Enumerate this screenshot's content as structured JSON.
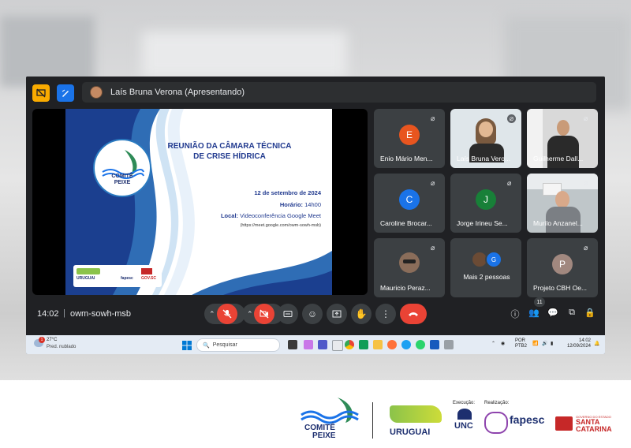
{
  "meet": {
    "presenter": "Laís Bruna Verona (Apresentando)",
    "time": "14:02",
    "code": "owm-sowh-msb",
    "participant_count": "11"
  },
  "slide": {
    "logo_line1": "COMITÊ",
    "logo_line2": "PEIXE",
    "title_line1": "REUNIÃO DA CÂMARA TÉCNICA",
    "title_line2": "DE CRISE HÍDRICA",
    "date": "12 de setembro de 2024",
    "hora_label": "Horário:",
    "hora_value": "14h00",
    "local_label": "Local:",
    "local_value": "Videoconferência Google Meet",
    "url": "(https://meet.google.com/owm-sowh-msb)",
    "footer_uruguai": "URUGUAI",
    "footer_fapesc": "fapesc",
    "footer_gov": "GOV.SC"
  },
  "participants": [
    {
      "name": "Enio Mário Men...",
      "initial": "E",
      "color": "#e8551f"
    },
    {
      "name": "Laís Bruna Vero...",
      "initial": "",
      "color": ""
    },
    {
      "name": "Guilherme Dall...",
      "initial": "",
      "color": ""
    },
    {
      "name": "Caroline Brocar...",
      "initial": "C",
      "color": "#1a73e8"
    },
    {
      "name": "Jorge Irineu Se...",
      "initial": "J",
      "color": "#188038"
    },
    {
      "name": "Murilo Anzanel...",
      "initial": "",
      "color": ""
    },
    {
      "name": "Mauricio Peraz...",
      "initial": "",
      "color": ""
    },
    {
      "name": "Mais 2 pessoas",
      "initial": "G",
      "color": "#1a73e8"
    },
    {
      "name": "Projeto CBH Oe...",
      "initial": "P",
      "color": "#a1887f"
    }
  ],
  "taskbar": {
    "temp": "27°C",
    "weather": "Pred. nublado",
    "search_placeholder": "Pesquisar",
    "lang1": "POR",
    "lang2": "PTB2",
    "clock_time": "14:02",
    "clock_date": "12/09/2024",
    "weather_badge": "1"
  },
  "footer": {
    "comite_line1": "COMITÊ",
    "comite_line2": "PEIXE",
    "uruguai": "URUGUAI",
    "execucao": "Execução:",
    "unc": "UNC",
    "realizacao": "Realização:",
    "fapesc": "fapesc",
    "gov_line1": "GOVERNO DO ESTADO",
    "gov_line2": "SANTA",
    "gov_line3": "CATARINA"
  },
  "colors": {
    "meet_bg": "#202124",
    "end_call": "#ea4335",
    "slide_blue": "#213a8f"
  }
}
